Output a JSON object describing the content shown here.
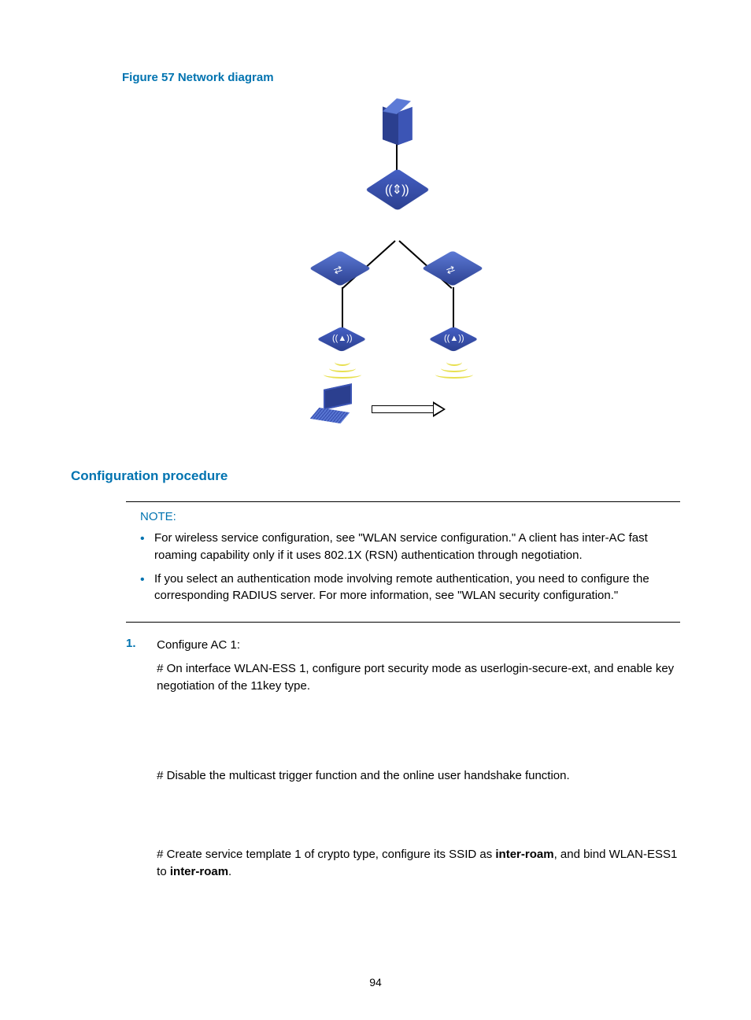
{
  "figure_title": "Figure 57 Network diagram",
  "section_heading": "Configuration procedure",
  "note": {
    "label": "NOTE:",
    "items": [
      "For wireless service configuration, see \"WLAN service configuration.\" A client has inter-AC fast roaming capability only if it uses 802.1X (RSN) authentication through negotiation.",
      "If you select an authentication mode involving remote authentication, you need to configure the corresponding RADIUS server. For more information, see \"WLAN security configuration.\""
    ]
  },
  "step": {
    "number": "1.",
    "title": "Configure AC 1:",
    "p1": "# On interface WLAN-ESS 1, configure port security mode as userlogin-secure-ext, and enable key negotiation of the 11key type.",
    "p2": "# Disable the multicast trigger function and the online user handshake function.",
    "p3_pre": "# Create service template 1 of crypto type, configure its SSID as ",
    "p3_b1": "inter-roam",
    "p3_mid": ", and bind WLAN-ESS1 to ",
    "p3_b2": "inter-roam",
    "p3_post": "."
  },
  "page_number": "94"
}
